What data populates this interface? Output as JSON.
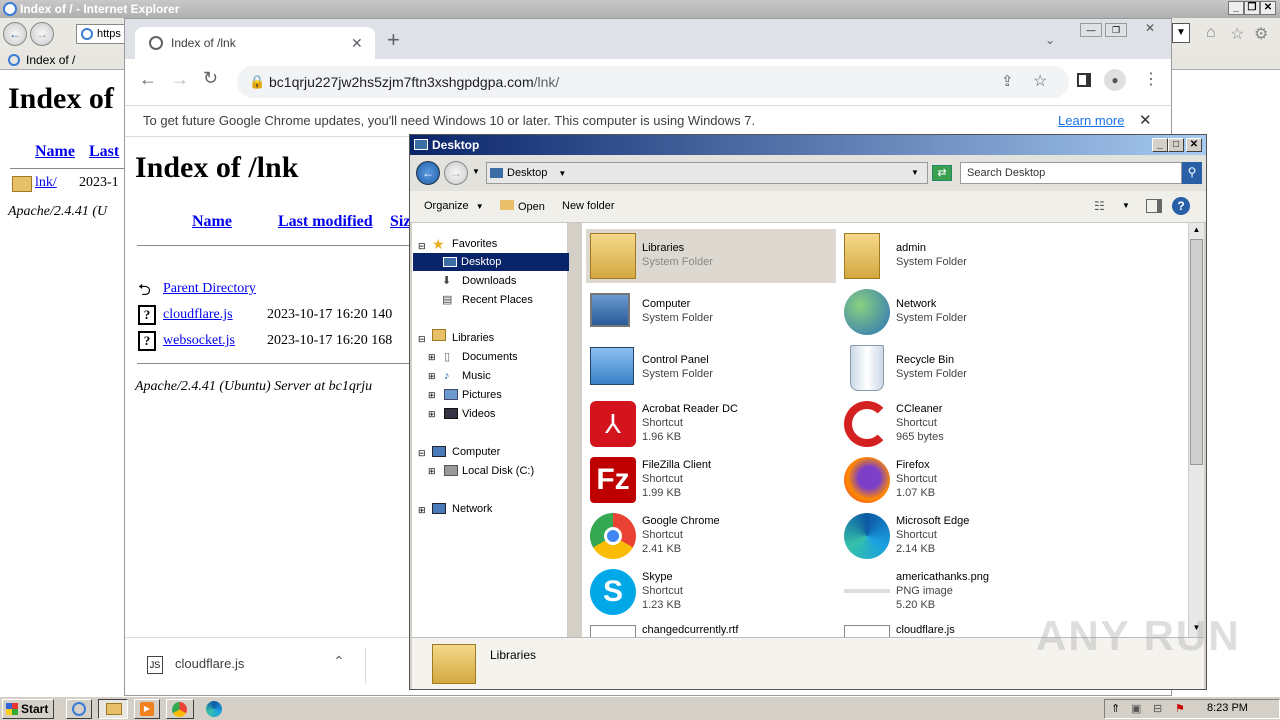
{
  "ie": {
    "title": "Index of / - Internet Explorer",
    "address": "https",
    "tab": "Index of /",
    "heading": "Index of",
    "col_name": "Name",
    "col_last": "Last",
    "row_link": "lnk/",
    "row_date": "2023-1",
    "footer": "Apache/2.4.41 (U"
  },
  "chrome": {
    "tab_title": "Index of /lnk",
    "url_host": "bc1qrju227jw2hs5zjm7ftn3xshgpdgpa.com",
    "url_path": "/lnk/",
    "info_text": "To get future Google Chrome updates, you'll need Windows 10 or later. This computer is using Windows 7.",
    "learn_more": "Learn more",
    "page": {
      "heading": "Index of /lnk",
      "col_name": "Name",
      "col_modified": "Last modified",
      "col_size": "Siz",
      "parent": "Parent Directory",
      "rows": [
        {
          "name": "cloudflare.js",
          "info": "2023-10-17 16:20 140"
        },
        {
          "name": "websocket.js",
          "info": "2023-10-17 16:20 168"
        }
      ],
      "footer": "Apache/2.4.41 (Ubuntu) Server at bc1qrju"
    },
    "download_file": "cloudflare.js"
  },
  "explorer": {
    "title": "Desktop",
    "address": "Desktop",
    "search_placeholder": "Search Desktop",
    "toolbar": {
      "organize": "Organize",
      "open": "Open",
      "new_folder": "New folder"
    },
    "nav": {
      "favorites": "Favorites",
      "desktop": "Desktop",
      "downloads": "Downloads",
      "recent": "Recent Places",
      "libraries": "Libraries",
      "documents": "Documents",
      "music": "Music",
      "pictures": "Pictures",
      "videos": "Videos",
      "computer": "Computer",
      "local_disk": "Local Disk (C:)",
      "network": "Network"
    },
    "items": [
      {
        "name": "Libraries",
        "type": "System Folder",
        "size": ""
      },
      {
        "name": "admin",
        "type": "System Folder",
        "size": ""
      },
      {
        "name": "Computer",
        "type": "System Folder",
        "size": ""
      },
      {
        "name": "Network",
        "type": "System Folder",
        "size": ""
      },
      {
        "name": "Control Panel",
        "type": "System Folder",
        "size": ""
      },
      {
        "name": "Recycle Bin",
        "type": "System Folder",
        "size": ""
      },
      {
        "name": "Acrobat Reader DC",
        "type": "Shortcut",
        "size": "1.96 KB"
      },
      {
        "name": "CCleaner",
        "type": "Shortcut",
        "size": "965 bytes"
      },
      {
        "name": "FileZilla Client",
        "type": "Shortcut",
        "size": "1.99 KB"
      },
      {
        "name": "Firefox",
        "type": "Shortcut",
        "size": "1.07 KB"
      },
      {
        "name": "Google Chrome",
        "type": "Shortcut",
        "size": "2.41 KB"
      },
      {
        "name": "Microsoft Edge",
        "type": "Shortcut",
        "size": "2.14 KB"
      },
      {
        "name": "Skype",
        "type": "Shortcut",
        "size": "1.23 KB"
      },
      {
        "name": "americathanks.png",
        "type": "PNG image",
        "size": "5.20 KB"
      },
      {
        "name": "changedcurrently.rtf",
        "type": "",
        "size": ""
      },
      {
        "name": "cloudflare.js",
        "type": "",
        "size": ""
      }
    ],
    "details_name": "Libraries"
  },
  "taskbar": {
    "start": "Start",
    "clock": "8:23 PM"
  },
  "watermark": "ANY RUN"
}
